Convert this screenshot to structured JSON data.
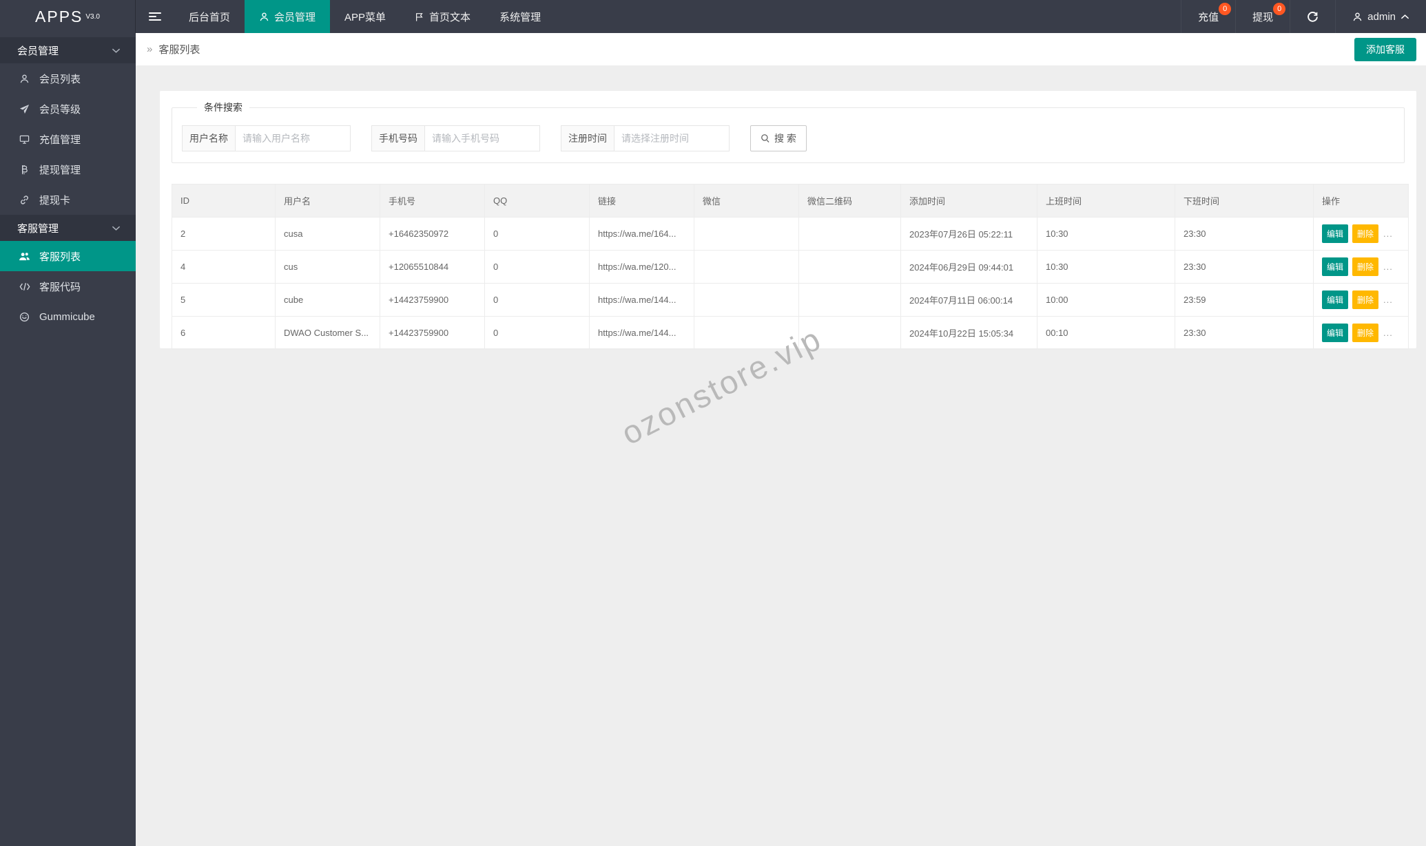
{
  "topbar": {
    "logo": "APPS",
    "version": "V3.0",
    "menu": [
      {
        "label": "后台首页",
        "icon": null
      },
      {
        "label": "会员管理",
        "icon": "user-icon",
        "active": true
      },
      {
        "label": "APP菜单",
        "icon": null
      },
      {
        "label": "首页文本",
        "icon": "flag-icon"
      },
      {
        "label": "系统管理",
        "icon": null
      }
    ],
    "right": {
      "recharge": {
        "label": "充值",
        "badge": "0"
      },
      "withdraw": {
        "label": "提现",
        "badge": "0"
      },
      "refresh_icon": "refresh-icon",
      "user": {
        "label": "admin",
        "icon": "user-icon",
        "caret": "chevron-up-icon"
      }
    }
  },
  "sidebar": {
    "groups": [
      {
        "label": "会员管理",
        "chevron": "chevron-down-icon",
        "items": [
          {
            "label": "会员列表",
            "icon": "user-icon"
          },
          {
            "label": "会员等级",
            "icon": "send-icon"
          },
          {
            "label": "充值管理",
            "icon": "monitor-icon"
          },
          {
            "label": "提现管理",
            "icon": "bitcoin-icon"
          },
          {
            "label": "提现卡",
            "icon": "link-icon"
          }
        ]
      },
      {
        "label": "客服管理",
        "chevron": "chevron-down-icon",
        "items": [
          {
            "label": "客服列表",
            "icon": "users-icon",
            "active": true
          },
          {
            "label": "客服代码",
            "icon": "code-icon"
          },
          {
            "label": "Gummicube",
            "icon": "circle-logo-icon"
          }
        ]
      }
    ]
  },
  "page": {
    "breadcrumb_arrow": "»",
    "breadcrumb_title": "客服列表",
    "add_button": "添加客服"
  },
  "search": {
    "legend": "条件搜索",
    "fields": [
      {
        "label": "用户名称",
        "placeholder": "请输入用户名称"
      },
      {
        "label": "手机号码",
        "placeholder": "请输入手机号码"
      },
      {
        "label": "注册时间",
        "placeholder": "请选择注册时间"
      }
    ],
    "button": "搜 索",
    "button_icon": "search-icon"
  },
  "table": {
    "headers": [
      "ID",
      "用户名",
      "手机号",
      "QQ",
      "链接",
      "微信",
      "微信二维码",
      "添加时间",
      "上班时间",
      "下班时间",
      "操作"
    ],
    "rows": [
      {
        "id": "2",
        "username": "cusa",
        "phone": "+16462350972",
        "qq": "0",
        "link": "https://wa.me/164...",
        "wechat": "",
        "wechat_qr": "",
        "added": "2023年07月26日 05:22:11",
        "start": "10:30",
        "end": "23:30"
      },
      {
        "id": "4",
        "username": "cus",
        "phone": "+12065510844",
        "qq": "0",
        "link": "https://wa.me/120...",
        "wechat": "",
        "wechat_qr": "",
        "added": "2024年06月29日 09:44:01",
        "start": "10:30",
        "end": "23:30"
      },
      {
        "id": "5",
        "username": "cube",
        "phone": "+14423759900",
        "qq": "0",
        "link": "https://wa.me/144...",
        "wechat": "",
        "wechat_qr": "",
        "added": "2024年07月11日 06:00:14",
        "start": "10:00",
        "end": "23:59"
      },
      {
        "id": "6",
        "username": "DWAO Customer S...",
        "phone": "+14423759900",
        "qq": "0",
        "link": "https://wa.me/144...",
        "wechat": "",
        "wechat_qr": "",
        "added": "2024年10月22日 15:05:34",
        "start": "00:10",
        "end": "23:30"
      }
    ],
    "actions": {
      "edit": "编辑",
      "delete": "删除",
      "more": "..."
    }
  },
  "watermark": "ozonstore.vip",
  "colors": {
    "dark": "#393D49",
    "dark_header": "#30343F",
    "teal": "#009688",
    "badge": "#FF5722",
    "amber": "#FFB800",
    "page_bg": "#eeeeee"
  }
}
